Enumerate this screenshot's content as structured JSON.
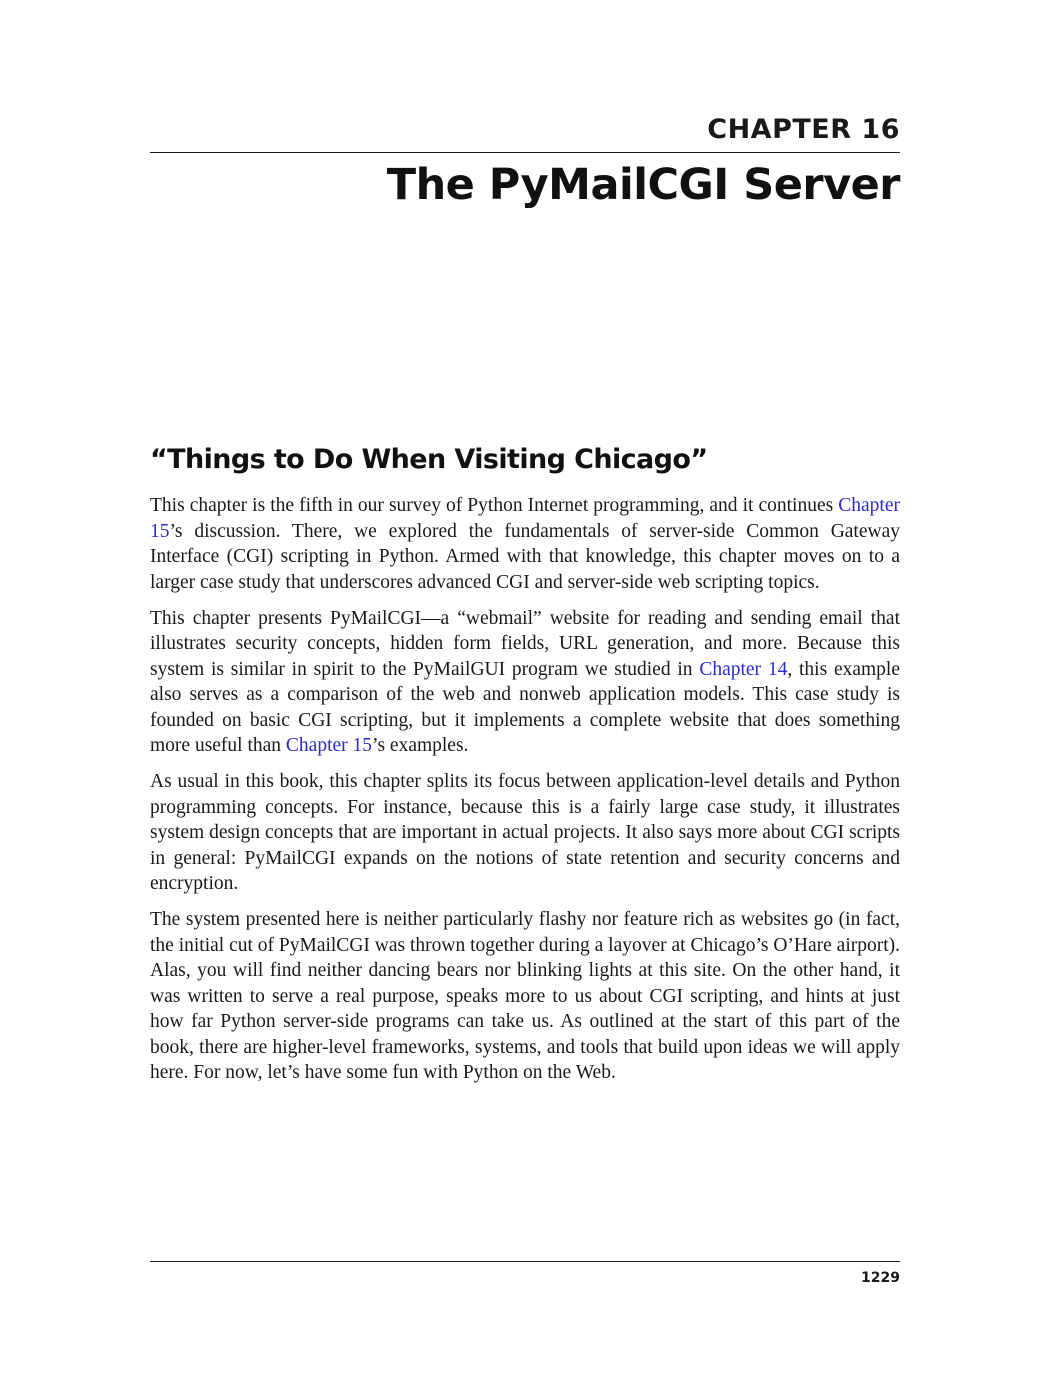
{
  "header": {
    "chapter_label": "CHAPTER 16",
    "chapter_title": "The PyMailCGI Server"
  },
  "section": {
    "heading": "“Things to Do When Visiting Chicago”"
  },
  "paragraphs": {
    "p1": {
      "link1": "Chapter 15",
      "t0": "This chapter is the fifth in our survey of Python Internet programming, and it continues ",
      "t1": "’s discussion. There, we explored the fundamentals of server-side Common Gateway Interface (CGI) scripting in Python. Armed with that knowledge, this chapter moves on to a larger case study that underscores advanced CGI and server-side web scripting topics."
    },
    "p2": {
      "t0": "This chapter presents PyMailCGI—a “webmail” website for reading and sending email that illustrates security concepts, hidden form fields, URL generation, and more. Because this system is similar in spirit to the PyMailGUI program we studied in ",
      "link1": "Chapter 14",
      "t1": ", this example also serves as a comparison of the web and nonweb application models. This case study is founded on basic CGI scripting, but it implements a complete website that does something more useful than ",
      "link2": "Chapter 15",
      "t2": "’s examples."
    },
    "p3": {
      "t0": "As usual in this book, this chapter splits its focus between application-level details and Python programming concepts. For instance, because this is a fairly large case study, it illustrates system design concepts that are important in actual projects. It also says more about CGI scripts in general: PyMailCGI expands on the notions of state retention and security concerns and encryption."
    },
    "p4": {
      "t0": "The system presented here is neither particularly flashy nor feature rich as websites go (in fact, the initial cut of PyMailCGI was thrown together during a layover at Chicago’s O’Hare airport). Alas, you will find neither dancing bears nor blinking lights at this site. On the other hand, it was written to serve a real purpose, speaks more to us about CGI scripting, and hints at just how far Python server-side programs can take us. As outlined at the start of this part of the book, there are higher-level frameworks, systems, and tools that build upon ideas we will apply here. For now, let’s have some fun with Python on the Web."
    }
  },
  "footer": {
    "page_number": "1229"
  },
  "colors": {
    "link": "#2a2acb",
    "text": "#1a1a1a"
  }
}
